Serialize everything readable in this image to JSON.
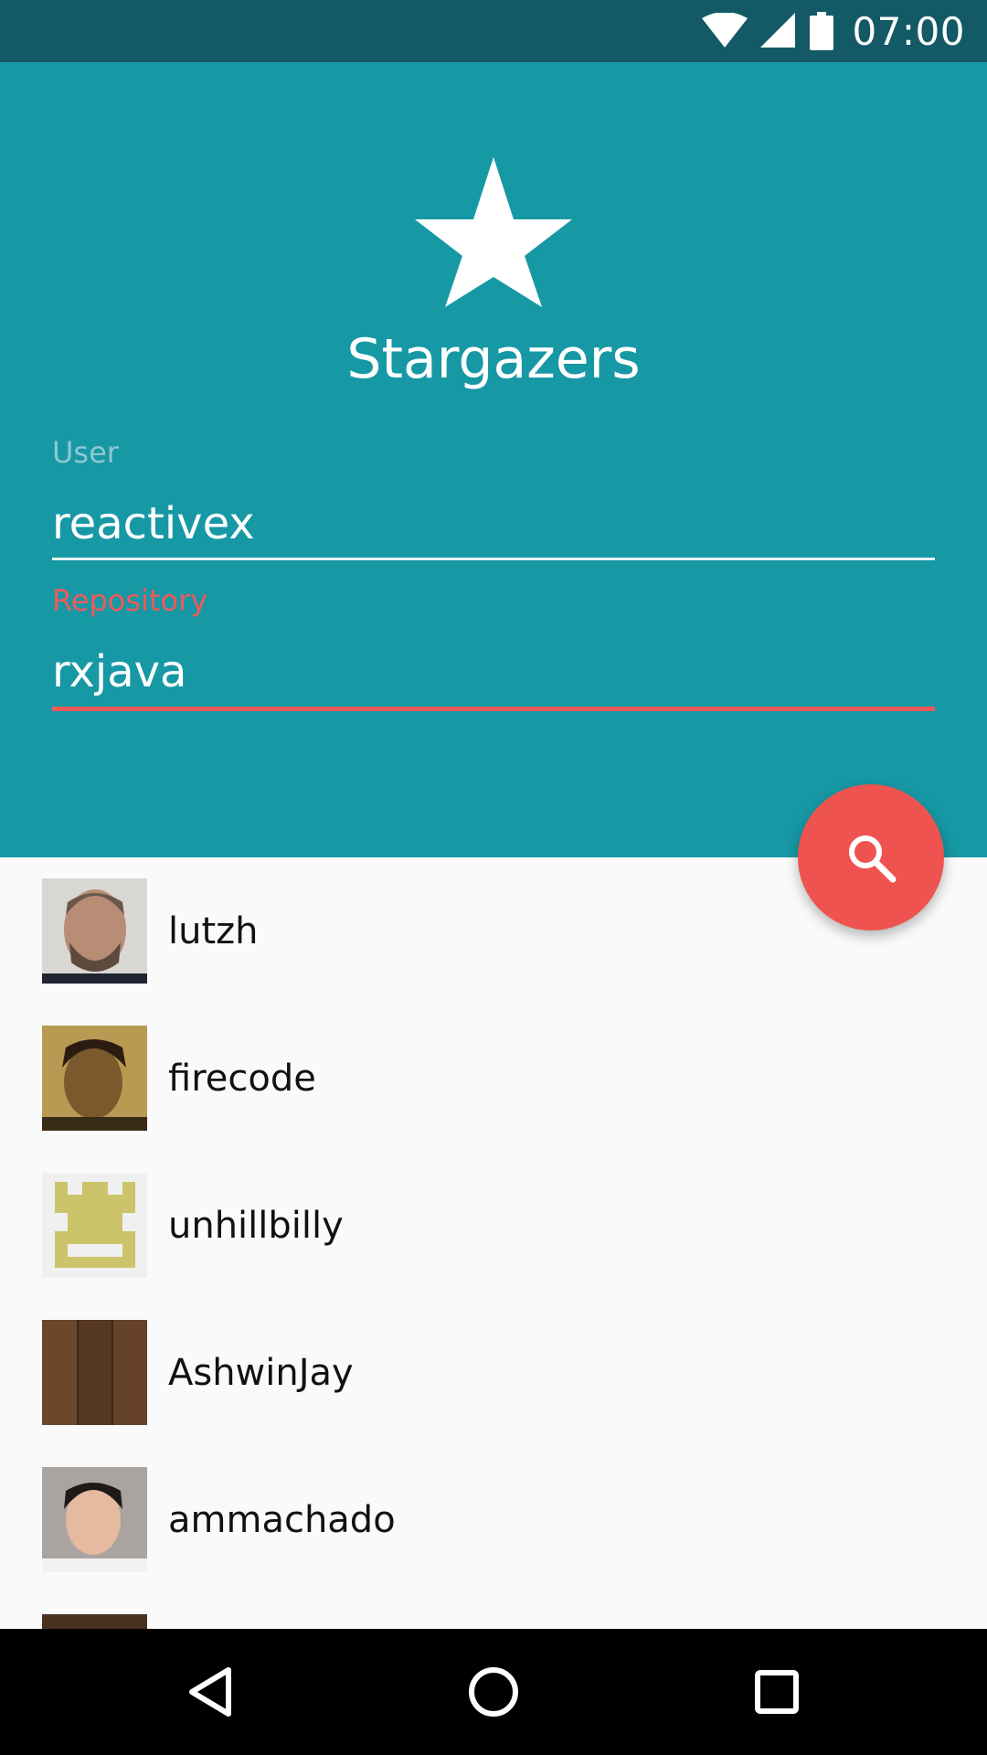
{
  "status_bar": {
    "time": "07:00",
    "icons": [
      "wifi-icon",
      "cell-signal-icon",
      "battery-icon"
    ]
  },
  "header": {
    "title": "Stargazers",
    "icon": "star-icon",
    "background": "#1798a5"
  },
  "form": {
    "user_label": "User",
    "user_value": "reactivex",
    "repo_label": "Repository",
    "repo_value": "rxjava",
    "focused_color": "#ee5a5a"
  },
  "fab": {
    "icon": "search-icon",
    "color": "#ef5350"
  },
  "stargazers": [
    {
      "username": "lutzh"
    },
    {
      "username": "firecode"
    },
    {
      "username": "unhillbilly"
    },
    {
      "username": "AshwinJay"
    },
    {
      "username": "ammachado"
    },
    {
      "username": ""
    }
  ],
  "nav_bar": {
    "icons": [
      "back-icon",
      "home-icon",
      "recents-icon"
    ]
  }
}
